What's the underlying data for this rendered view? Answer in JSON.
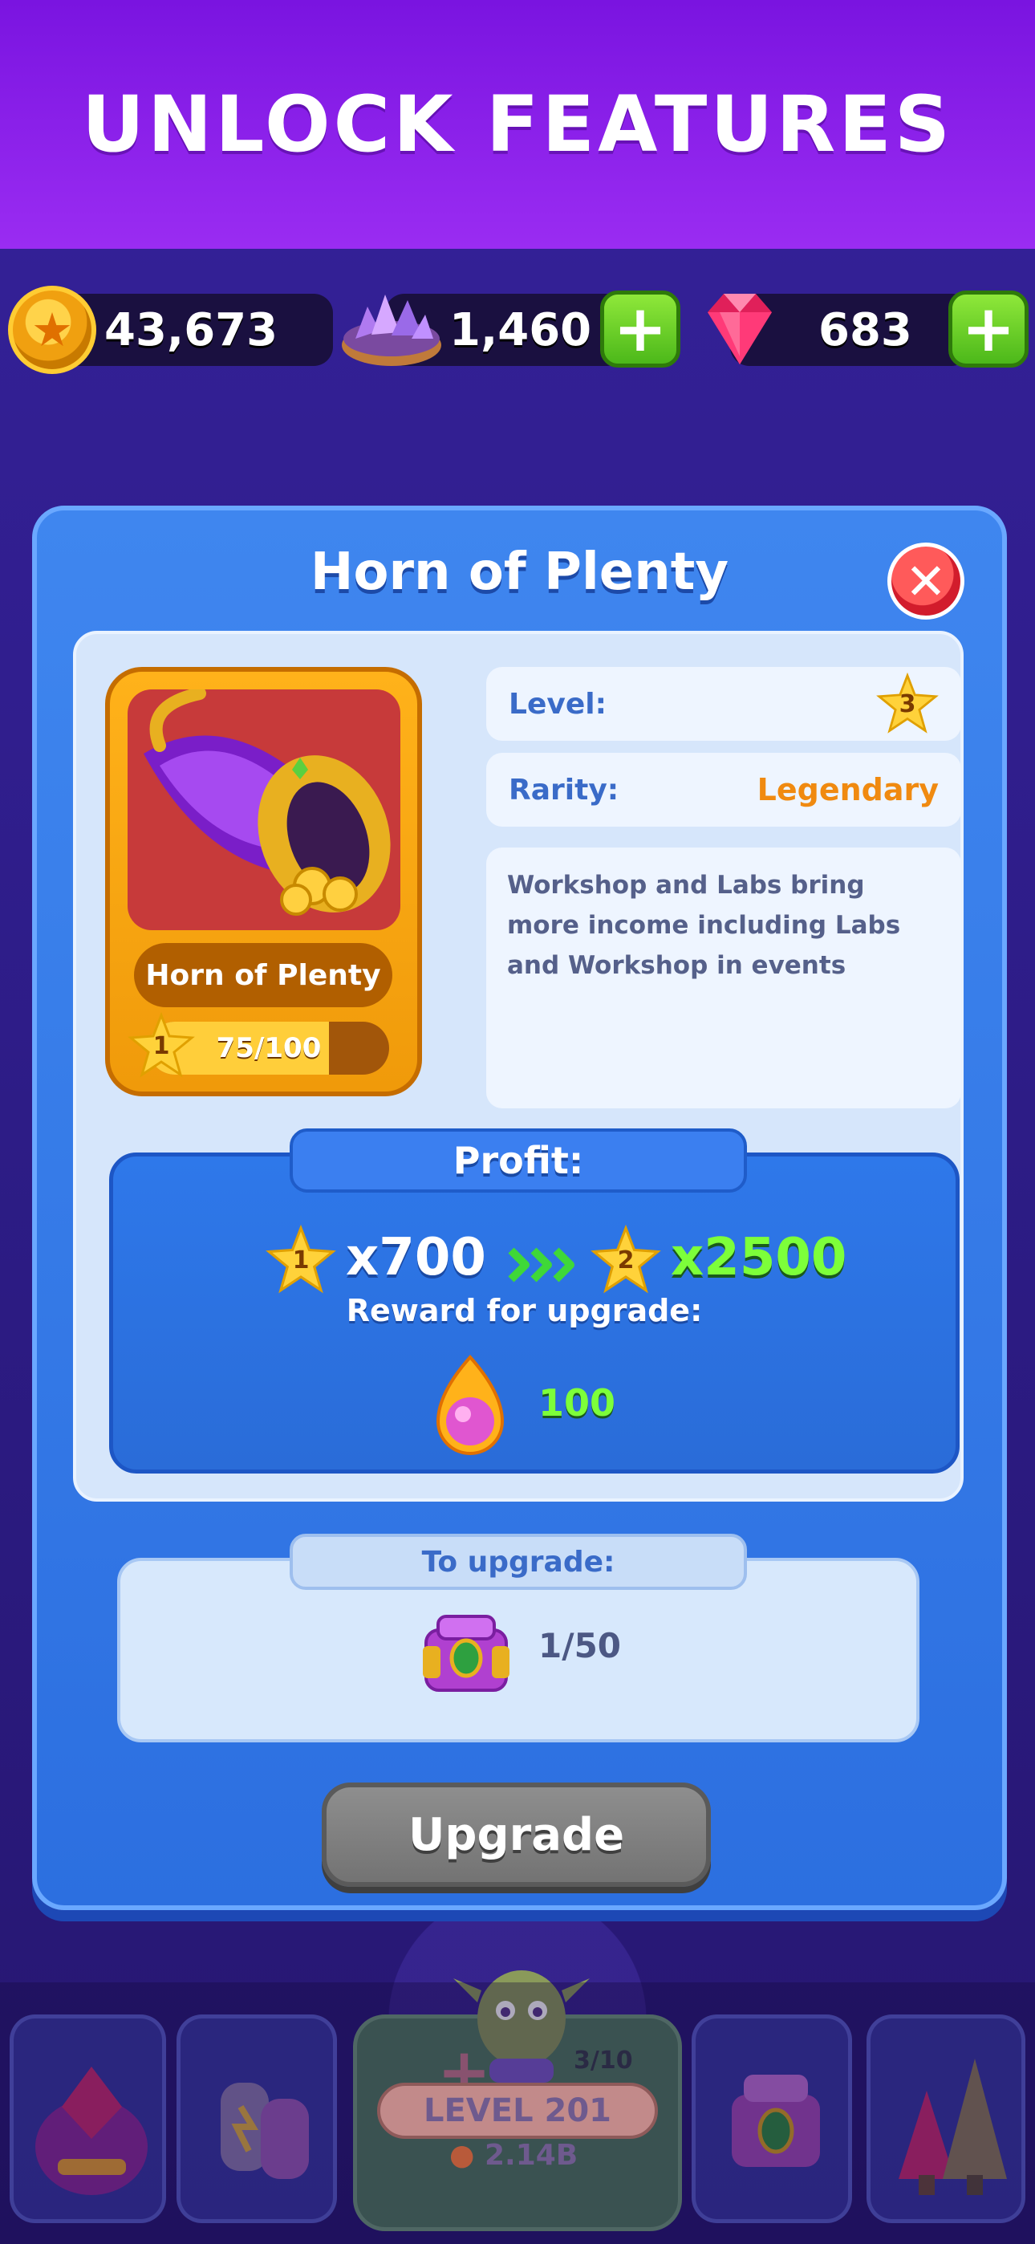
{
  "header": {
    "title": "UNLOCK FEATURES"
  },
  "currencies": {
    "coins": {
      "value": "43,673",
      "icon": "coin-icon"
    },
    "crystals": {
      "value": "1,460",
      "icon": "crystal-bowl-icon",
      "plus": "+"
    },
    "gems": {
      "value": "683",
      "icon": "gem-icon",
      "plus": "+"
    }
  },
  "modal": {
    "title": "Horn of Plenty",
    "close": "✕",
    "card": {
      "name": "Horn of Plenty",
      "star_level": "1",
      "progress_text": "75/100",
      "progress_fraction": 0.75
    },
    "level": {
      "label": "Level:",
      "value": "3"
    },
    "rarity": {
      "label": "Rarity:",
      "value": "Legendary"
    },
    "description": "Workshop and Labs bring more income including Labs and Workshop in events",
    "profit": {
      "label": "Profit:",
      "from_star": "1",
      "from_mult": "x700",
      "to_star": "2",
      "to_mult": "x2500",
      "reward_label": "Reward for upgrade:",
      "reward_value": "100"
    },
    "upgrade": {
      "label": "To upgrade:",
      "count": "1/50",
      "button": "Upgrade"
    }
  },
  "bottom_nav": {
    "level_text": "LEVEL 201",
    "level_progress": "3/10",
    "coins": "2.14B"
  },
  "colors": {
    "banner": "#8a1ee8",
    "modal": "#3a7fec",
    "rarity": "#f08a10",
    "profit_new": "#7dff3a",
    "button_disabled": "#7f7f7f"
  }
}
